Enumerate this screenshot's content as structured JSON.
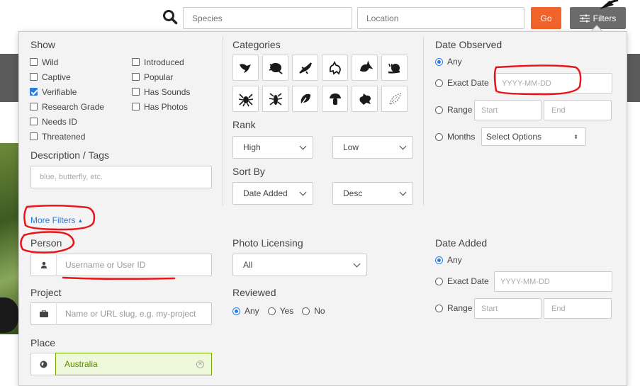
{
  "topbar": {
    "species_placeholder": "Species",
    "location_placeholder": "Location",
    "go_label": "Go",
    "filters_label": "Filters"
  },
  "show": {
    "title": "Show",
    "left": [
      {
        "label": "Wild",
        "checked": false
      },
      {
        "label": "Captive",
        "checked": false
      },
      {
        "label": "Verifiable",
        "checked": true
      },
      {
        "label": "Research Grade",
        "checked": false
      },
      {
        "label": "Needs ID",
        "checked": false
      },
      {
        "label": "Threatened",
        "checked": false
      }
    ],
    "right": [
      {
        "label": "Introduced",
        "checked": false
      },
      {
        "label": "Popular",
        "checked": false
      },
      {
        "label": "Has Sounds",
        "checked": false
      },
      {
        "label": "Has Photos",
        "checked": false
      }
    ]
  },
  "description": {
    "title": "Description / Tags",
    "placeholder": "blue, butterfly, etc."
  },
  "more_filters_label": "More Filters",
  "categories": {
    "title": "Categories",
    "icons": [
      "bird-icon",
      "amphibian-icon",
      "reptile-icon",
      "mammal-icon",
      "fish-icon",
      "mollusk-icon",
      "spider-icon",
      "insect-icon",
      "plant-icon",
      "fungi-icon",
      "protozoa-icon",
      "unknown-icon"
    ]
  },
  "rank": {
    "title": "Rank",
    "high": "High",
    "low": "Low"
  },
  "sort_by": {
    "title": "Sort By",
    "field": "Date Added",
    "order": "Desc"
  },
  "date_observed": {
    "title": "Date Observed",
    "any": "Any",
    "exact_date": "Exact Date",
    "exact_placeholder": "YYYY-MM-DD",
    "range": "Range",
    "start": "Start",
    "end": "End",
    "months": "Months",
    "months_select": "Select Options"
  },
  "person": {
    "title": "Person",
    "placeholder": "Username or User ID"
  },
  "project": {
    "title": "Project",
    "placeholder": "Name or URL slug, e.g. my-project"
  },
  "place": {
    "title": "Place",
    "value": "Australia"
  },
  "photo_licensing": {
    "title": "Photo Licensing",
    "value": "All"
  },
  "reviewed": {
    "title": "Reviewed",
    "options": [
      "Any",
      "Yes",
      "No"
    ]
  },
  "date_added": {
    "title": "Date Added",
    "any": "Any",
    "exact_date": "Exact Date",
    "exact_placeholder": "YYYY-MM-DD",
    "range": "Range",
    "start": "Start",
    "end": "End"
  },
  "colors": {
    "accent": "#2a7ae2",
    "go_button": "#f0632a",
    "annotation": "#e8161b",
    "place_border": "#74ac00"
  }
}
